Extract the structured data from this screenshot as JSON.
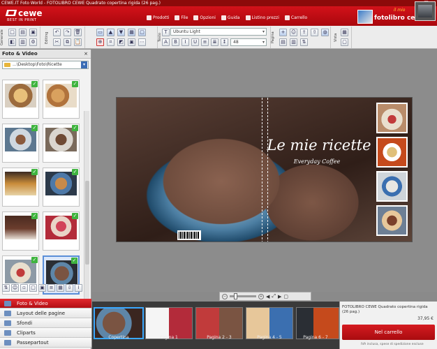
{
  "titlebar": "CEWE.IT Foto World - FOTOLIBRO CEWE Quadrato copertina rigida (26 pag.)",
  "logo": {
    "brand": "cewe",
    "tagline": "BEST IN PRINT"
  },
  "menu": [
    {
      "label": "Prodotti",
      "icon": "products-icon"
    },
    {
      "label": "File",
      "icon": "file-icon"
    },
    {
      "label": "Opzioni",
      "icon": "options-icon"
    },
    {
      "label": "Guida",
      "icon": "help-icon"
    },
    {
      "label": "Listino prezzi",
      "icon": "price-list-icon"
    },
    {
      "label": "Carrello",
      "icon": "cart-icon"
    }
  ],
  "promo": {
    "text": "fotolibro cewe",
    "mini": "il mio"
  },
  "toolbar": {
    "group1": "Generale",
    "group2": "Editing",
    "group3": "Testo",
    "group4": "Pagina",
    "group5": "Vista",
    "font": "Ubuntu Light",
    "size": "48"
  },
  "leftpanel": {
    "title": "Foto & Video",
    "path": "...\\Desktop\\Foto\\Ricette"
  },
  "nav": [
    {
      "label": "Foto & Video",
      "active": true
    },
    {
      "label": "Layout delle pagine",
      "active": false
    },
    {
      "label": "Sfondi",
      "active": false
    },
    {
      "label": "Cliparts",
      "active": false
    },
    {
      "label": "Passepartout",
      "active": false
    }
  ],
  "cover": {
    "title": "Le mie ricette",
    "subtitle": "Everyday Coffee"
  },
  "pages": [
    {
      "label": "Copertina"
    },
    {
      "label": "Pagina 1"
    },
    {
      "label": "Pagina 2 - 3"
    },
    {
      "label": "Pagina 4 - 5"
    },
    {
      "label": "Pagina 6 - 7"
    }
  ],
  "cart": {
    "description": "FOTOLIBRO CEWE Quadrato copertina rigida (26 pag.)",
    "price": "37,95 €",
    "button": "Nel carrello",
    "note": "IVA inclusa, spese di spedizione escluse"
  }
}
